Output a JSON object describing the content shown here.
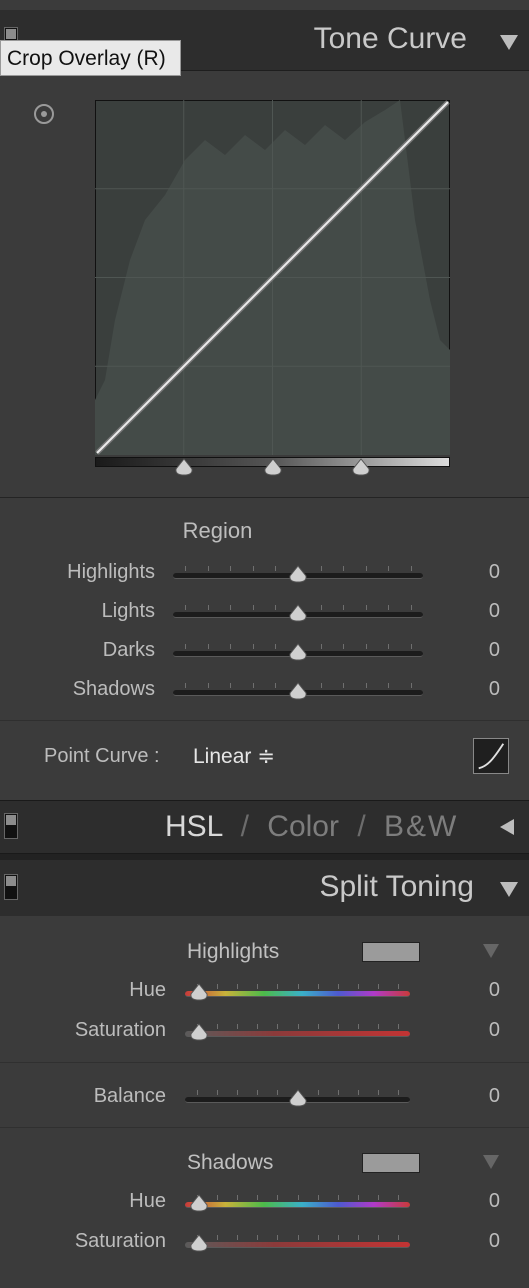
{
  "tone_curve": {
    "title": "Tone Curve",
    "tooltip": "Crop Overlay (R)",
    "region": {
      "label": "Region",
      "rows": [
        {
          "label": "Highlights",
          "value": "0",
          "level": 0.5
        },
        {
          "label": "Lights",
          "value": "0",
          "level": 0.5
        },
        {
          "label": "Darks",
          "value": "0",
          "level": 0.5
        },
        {
          "label": "Shadows",
          "value": "0",
          "level": 0.5
        }
      ]
    },
    "split_points": [
      0.25,
      0.5,
      0.75
    ],
    "point_curve": {
      "label": "Point Curve :",
      "value": "Linear ≑"
    }
  },
  "hsl": {
    "hsl": "HSL",
    "sep1": "/",
    "color": "Color",
    "sep2": "/",
    "bw": "B&W"
  },
  "split_toning": {
    "title": "Split Toning",
    "highlights": {
      "label": "Highlights",
      "rows": [
        {
          "label": "Hue",
          "value": "0",
          "level": 0
        },
        {
          "label": "Saturation",
          "value": "0",
          "level": 0
        }
      ]
    },
    "balance": {
      "label": "Balance",
      "value": "0",
      "level": 0.5
    },
    "shadows": {
      "label": "Shadows",
      "rows": [
        {
          "label": "Hue",
          "value": "0",
          "level": 0
        },
        {
          "label": "Saturation",
          "value": "0",
          "level": 0
        }
      ]
    }
  },
  "icons": [
    "target-adjust-icon",
    "collapse-arrow-icon",
    "expand-arrow-icon",
    "point-curve-edit-icon",
    "panel-switch-icon",
    "swatch-arrow-icon"
  ],
  "colors": {
    "panel_bg": "#3b3b3b",
    "header_bg": "#2d2d2d",
    "curve_bg": "#3a3f3d",
    "curve_line": "#e8e8e8",
    "swatch": "#9b9b9b"
  }
}
